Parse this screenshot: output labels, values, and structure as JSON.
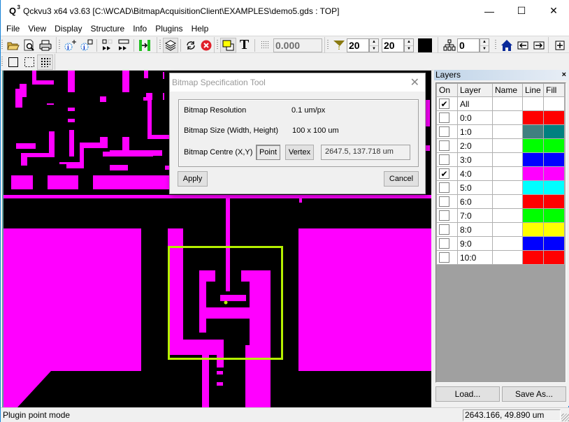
{
  "window": {
    "app_icon": "Q",
    "app_icon_sup": "3",
    "title": "Qckvu3 x64 v3.63 [C:\\WCAD\\BitmapAcquisitionClient\\EXAMPLES\\demo5.gds : TOP]",
    "minimize_glyph": "—",
    "maximize_glyph": "☐",
    "close_glyph": "✕"
  },
  "menu": [
    "File",
    "View",
    "Display",
    "Structure",
    "Info",
    "Plugins",
    "Help"
  ],
  "toolbar": {
    "open_icon": "📂",
    "preview_icon": "🔍",
    "print_icon": "🖶",
    "info_plus_label": "i",
    "info_box_label": "i",
    "layers_icon": "≋",
    "refresh_icon": "⟳",
    "stop_icon": "✕",
    "text_icon": "T",
    "grid_icon": "⠿",
    "snap_value": "0.000",
    "filter_icon": "Y",
    "width_value": "20",
    "height_value": "20",
    "color_swatch": "#000000",
    "hierarchy_icon": "⋔",
    "hierarchy_value": "0",
    "home_icon": "⌂",
    "back_icon": "←",
    "forward_icon": "→",
    "zoom_in_icon": "+",
    "spin_up": "▲",
    "spin_down": "▼"
  },
  "selection_toolbar": {
    "rect_icon": "☐",
    "dotted_rect_icon": "⬚",
    "grid_select_icon": "⠿"
  },
  "colors": {
    "layer_fill": "#ff00ff",
    "selection_box": "#b4f000",
    "canvas_bg": "#000000"
  },
  "layers_panel": {
    "title": "Layers",
    "close": "×",
    "columns": [
      "On",
      "Layer",
      "Name",
      "Line",
      "Fill"
    ],
    "rows": [
      {
        "on": true,
        "layer": "All",
        "name": "",
        "line": "#ffffff",
        "fill": "#ffffff"
      },
      {
        "on": false,
        "layer": "0:0",
        "name": "",
        "line": "#ff0000",
        "fill": "#ff0000"
      },
      {
        "on": false,
        "layer": "1:0",
        "name": "",
        "line": "#408080",
        "fill": "#008080"
      },
      {
        "on": false,
        "layer": "2:0",
        "name": "",
        "line": "#00ff00",
        "fill": "#00ff00"
      },
      {
        "on": false,
        "layer": "3:0",
        "name": "",
        "line": "#0000ff",
        "fill": "#0000ff"
      },
      {
        "on": true,
        "layer": "4:0",
        "name": "",
        "line": "#ff00ff",
        "fill": "#ff00ff"
      },
      {
        "on": false,
        "layer": "5:0",
        "name": "",
        "line": "#00ffff",
        "fill": "#00ffff"
      },
      {
        "on": false,
        "layer": "6:0",
        "name": "",
        "line": "#ff0000",
        "fill": "#ff0000"
      },
      {
        "on": false,
        "layer": "7:0",
        "name": "",
        "line": "#00ff00",
        "fill": "#00ff00"
      },
      {
        "on": false,
        "layer": "8:0",
        "name": "",
        "line": "#ffff00",
        "fill": "#ffff00"
      },
      {
        "on": false,
        "layer": "9:0",
        "name": "",
        "line": "#0000ff",
        "fill": "#0000ff"
      },
      {
        "on": false,
        "layer": "10:0",
        "name": "",
        "line": "#ff0000",
        "fill": "#ff0000"
      }
    ],
    "check_glyph": "✔",
    "load_label": "Load...",
    "save_as_label": "Save As..."
  },
  "dialog": {
    "title": "Bitmap Specification Tool",
    "close_glyph": "✕",
    "resolution_label": "Bitmap Resolution",
    "resolution_value": "0.1 um/px",
    "size_label": "Bitmap Size (Width, Height)",
    "size_value": "100 x 100 um",
    "centre_label": "Bitmap Centre (X,Y)",
    "point_label": "Point",
    "vertex_label": "Vertex",
    "centre_value": "2647.5, 137.718 um",
    "apply_label": "Apply",
    "cancel_label": "Cancel"
  },
  "status": {
    "mode": "Plugin point mode",
    "coords": "2643.166, 49.890 um"
  }
}
